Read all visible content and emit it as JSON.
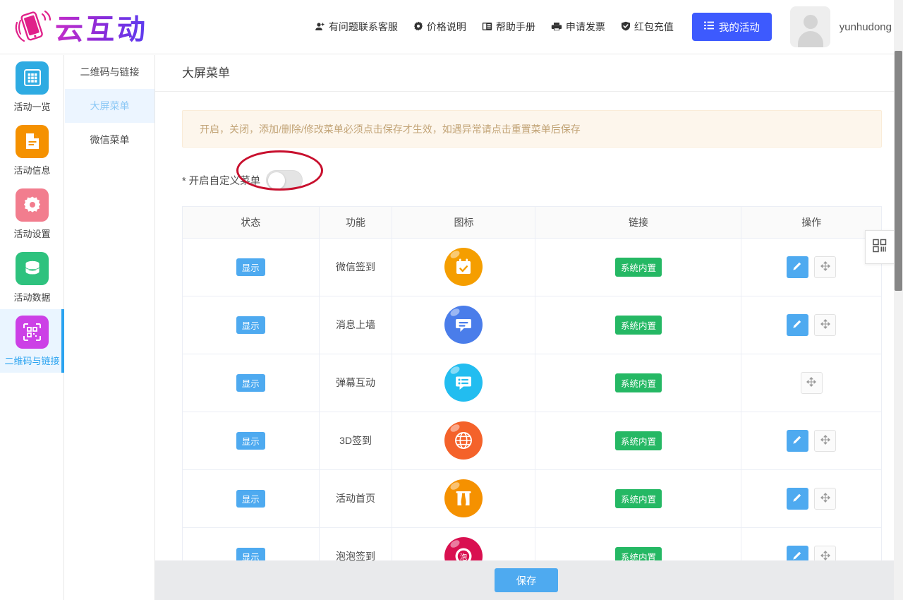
{
  "header": {
    "brand_name": "云互动",
    "brand_icon": "phone-hand-icon",
    "nav": [
      {
        "label": "有问题联系客服",
        "icon": "user-add-icon"
      },
      {
        "label": "价格说明",
        "icon": "gear-icon"
      },
      {
        "label": "帮助手册",
        "icon": "book-icon"
      },
      {
        "label": "申请发票",
        "icon": "printer-icon"
      },
      {
        "label": "红包充值",
        "icon": "shield-check-icon"
      }
    ],
    "my_activity_label": "我的活动",
    "my_activity_icon": "list-icon",
    "username": "yunhudong",
    "avatar_icon": "user-avatar-icon",
    "caret_icon": "chevron-down-icon"
  },
  "sidebar": {
    "items": [
      {
        "label": "活动一览",
        "icon": "grid-icon",
        "color": "#2eabe2",
        "active": false
      },
      {
        "label": "活动信息",
        "icon": "document-icon",
        "color": "#f59100",
        "active": false
      },
      {
        "label": "活动设置",
        "icon": "gear-icon",
        "color": "#f27d8e",
        "active": false
      },
      {
        "label": "活动数据",
        "icon": "database-icon",
        "color": "#2ec27e",
        "active": false
      },
      {
        "label": "二维码与链接",
        "icon": "qrcode-icon",
        "color": "#cc40e6",
        "active": true
      }
    ]
  },
  "submenu": {
    "items": [
      {
        "label": "二维码与链接",
        "active": false
      },
      {
        "label": "大屏菜单",
        "active": true
      },
      {
        "label": "微信菜单",
        "active": false
      }
    ]
  },
  "main": {
    "card_title": "大屏菜单",
    "alert_text": "开启，关闭，添加/删除/修改菜单必须点击保存才生效，如遇异常请点击重置菜单后保存",
    "toggle": {
      "label": "* 开启自定义菜单",
      "state": "off",
      "annotation": "red-ellipse-highlight"
    },
    "table": {
      "columns": [
        "状态",
        "功能",
        "图标",
        "链接",
        "操作"
      ],
      "rows": [
        {
          "status": "显示",
          "feature": "微信签到",
          "icon_name": "calendar-check-icon",
          "icon_color": "#f59e00",
          "icon_glyph": "calendar",
          "link": "系统内置",
          "has_edit": true,
          "has_move": true
        },
        {
          "status": "显示",
          "feature": "消息上墙",
          "icon_name": "chat-bubble-icon",
          "icon_color": "#4a7dea",
          "icon_glyph": "chat",
          "link": "系统内置",
          "has_edit": true,
          "has_move": true
        },
        {
          "status": "显示",
          "feature": "弹幕互动",
          "icon_name": "chat-list-icon",
          "icon_color": "#22bdf0",
          "icon_glyph": "chatlist",
          "link": "系统内置",
          "has_edit": false,
          "has_move": true
        },
        {
          "status": "显示",
          "feature": "3D签到",
          "icon_name": "globe-icon",
          "icon_color": "#f4622a",
          "icon_glyph": "globe",
          "link": "系统内置",
          "has_edit": true,
          "has_move": true
        },
        {
          "status": "显示",
          "feature": "活动首页",
          "icon_name": "curtain-icon",
          "icon_color": "#f59100",
          "icon_glyph": "curtain",
          "link": "系统内置",
          "has_edit": true,
          "has_move": true
        },
        {
          "status": "显示",
          "feature": "泡泡签到",
          "icon_name": "bubble-seal-icon",
          "icon_color": "#d91050",
          "icon_glyph": "bubble",
          "link": "系统内置",
          "has_edit": true,
          "has_move": true
        }
      ],
      "edit_icon": "pencil-icon",
      "move_icon": "move-arrows-icon"
    }
  },
  "footer": {
    "save_label": "保存"
  },
  "float_widget": {
    "icon": "qrcode-icon"
  },
  "colors": {
    "accent_blue": "#4eaaf0",
    "primary_blue": "#3d5afe",
    "green": "#25b864",
    "alert_bg": "#fdf6ec",
    "alert_text": "#c2a477",
    "annotation_red": "#c8102e"
  }
}
